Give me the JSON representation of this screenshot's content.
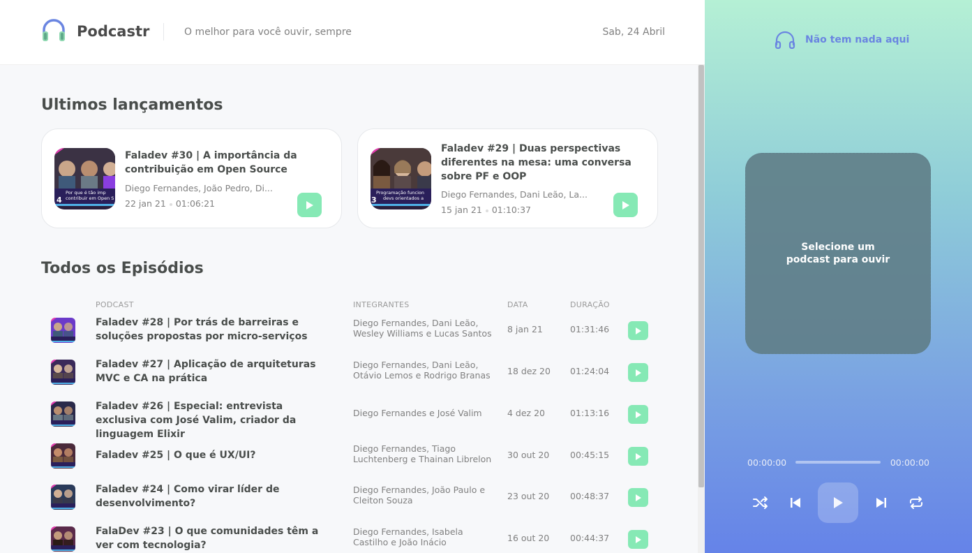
{
  "header": {
    "logo_text": "Podcastr",
    "tagline": "O melhor para você ouvir, sempre",
    "date": "Sab, 24 Abril"
  },
  "latest": {
    "title": "Ultimos lançamentos",
    "episodes": [
      {
        "title": "Faladev #30 | A importância da contribuição em Open Source",
        "members": "Diego Fernandes, João Pedro, Di...",
        "date": "22 jan 21",
        "duration": "01:06:21",
        "thumb_caption": "Por que é tão importante contribuir em Open Source",
        "thumb_number": "4"
      },
      {
        "title": "Faladev #29 | Duas perspectivas diferentes na mesa: uma conversa sobre PF e OOP",
        "members": "Diego Fernandes, Dani Leão, La...",
        "date": "15 jan 21",
        "duration": "01:10:37",
        "thumb_caption": "Programação funcional e devs orientados a objetos",
        "thumb_number": "3"
      }
    ]
  },
  "all": {
    "title": "Todos os Episódios",
    "columns": {
      "podcast": "PODCAST",
      "members": "INTEGRANTES",
      "date": "DATA",
      "duration": "DURAÇÃO"
    },
    "episodes": [
      {
        "title": "Faladev #28 | Por trás de barreiras e soluções propostas por micro-serviços",
        "members": "Diego Fernandes, Dani Leão, Wesley Williams e Lucas Santos",
        "date": "8 jan 21",
        "duration": "01:31:46"
      },
      {
        "title": "Faladev #27 | Aplicação de arquiteturas MVC e CA na prática",
        "members": "Diego Fernandes, Dani Leão, Otávio Lemos e Rodrigo Branas",
        "date": "18 dez 20",
        "duration": "01:24:04"
      },
      {
        "title": "Faladev #26 | Especial: entrevista exclusiva com José Valim, criador da linguagem Elixir",
        "members": "Diego Fernandes e José Valim",
        "date": "4 dez 20",
        "duration": "01:13:16"
      },
      {
        "title": "Faladev #25 | O que é UX/UI?",
        "members": "Diego Fernandes, Tiago Luchtenberg e Thainan Librelon",
        "date": "30 out 20",
        "duration": "00:45:15"
      },
      {
        "title": "Faladev #24 | Como virar líder de desenvolvimento?",
        "members": "Diego Fernandes, João Paulo e Cleiton Souza",
        "date": "23 out 20",
        "duration": "00:48:37"
      },
      {
        "title": "FalaDev #23 | O que comunidades têm a ver com tecnologia?",
        "members": "Diego Fernandes, Isabela Castilho e João Inácio",
        "date": "16 out 20",
        "duration": "00:44:37"
      }
    ]
  },
  "player": {
    "header_text": "Não tem nada aqui",
    "empty_message": "Selecione um podcast para ouvir",
    "current_time": "00:00:00",
    "total_time": "00:00:00",
    "progress": 0
  },
  "colors": {
    "accent_green": "#86e9b5",
    "player_title": "#6a85e1",
    "thumb_purple": "#8a3ee0",
    "thumb_pink": "#e83ab3"
  }
}
